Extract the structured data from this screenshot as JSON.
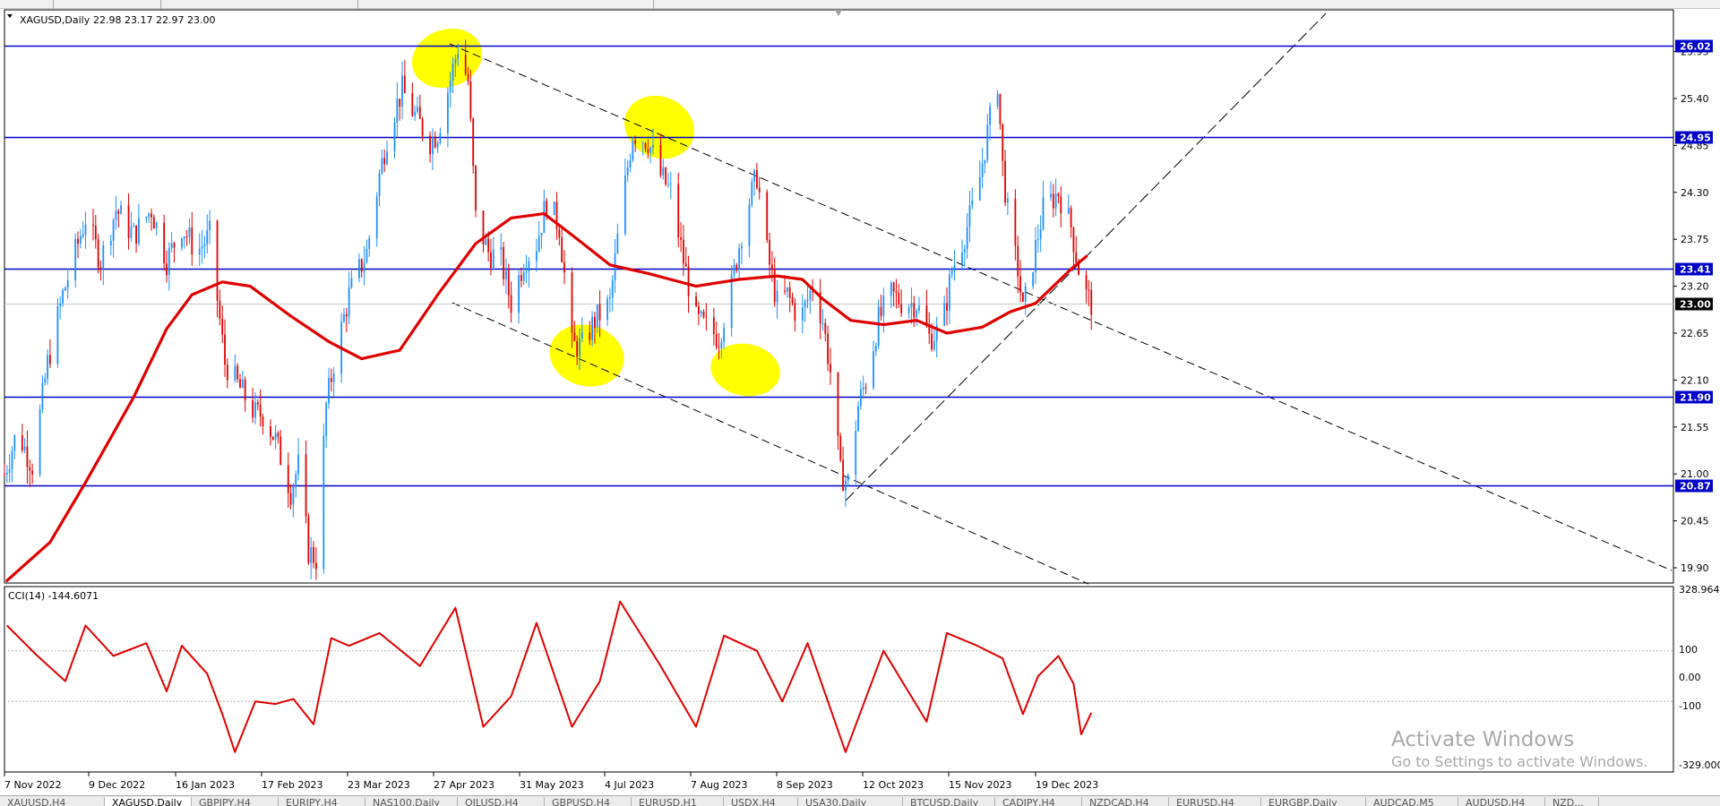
{
  "header": {
    "symbol": "XAGUSD,Daily",
    "ohlc": "22.98 23.17 22.97 23.00",
    "indicator_label": "CCI(14) -144.6071"
  },
  "colors": {
    "bull": "#1e90ff",
    "bear": "#e00000",
    "ma": "#e00000",
    "level_line": "#0000c8",
    "cci": "#e00000",
    "highlight": "#ffff00",
    "trendline": "#000000"
  },
  "horizontal_levels": [
    "26.02",
    "24.95",
    "23.41",
    "21.90",
    "20.87"
  ],
  "current_price": "23.00",
  "watermark": {
    "line1": "Activate Windows",
    "line2": "Go to Settings to activate Windows."
  },
  "tabs": [
    {
      "label": "XAUUSD,H4",
      "active": false
    },
    {
      "label": "XAGUSD,Daily",
      "active": true
    },
    {
      "label": "GBPJPY,H4",
      "active": false
    },
    {
      "label": "EURJPY,H4",
      "active": false
    },
    {
      "label": "NAS100,Daily",
      "active": false
    },
    {
      "label": "OILUSD,H4",
      "active": false
    },
    {
      "label": "GBPUSD,H4",
      "active": false
    },
    {
      "label": "EURUSD,H1",
      "active": false
    },
    {
      "label": "USDX,H4",
      "active": false
    },
    {
      "label": "USA30,Daily",
      "active": false
    },
    {
      "label": "BTCUSD,Daily",
      "active": false
    },
    {
      "label": "CADJPY,H4",
      "active": false
    },
    {
      "label": "NZDCAD,H4",
      "active": false
    },
    {
      "label": "EURUSD,H4",
      "active": false
    },
    {
      "label": "EURGBP,Daily",
      "active": false
    },
    {
      "label": "AUDCAD,M5",
      "active": false
    },
    {
      "label": "AUDUSD,H4",
      "active": false
    },
    {
      "label": "NZD...",
      "active": false
    }
  ],
  "chart_data": [
    {
      "type": "candlestick",
      "title": "XAGUSD,Daily",
      "y_ticks": [
        "25.95",
        "25.40",
        "24.85",
        "24.30",
        "23.75",
        "23.20",
        "22.65",
        "22.10",
        "21.55",
        "21.00",
        "20.45",
        "19.90"
      ],
      "ylim": [
        19.8,
        26.35
      ],
      "x_ticks": [
        "7 Nov 2022",
        "9 Dec 2022",
        "16 Jan 2023",
        "17 Feb 2023",
        "23 Mar 2023",
        "27 Apr 2023",
        "31 May 2023",
        "4 Jul 2023",
        "7 Aug 2023",
        "8 Sep 2023",
        "12 Oct 2023",
        "15 Nov 2023",
        "19 Dec 2023"
      ],
      "price_path": [
        {
          "date": "2022-11-07",
          "close": 21.0
        },
        {
          "date": "2022-11-12",
          "close": 21.5
        },
        {
          "date": "2022-11-18",
          "close": 21.1
        },
        {
          "date": "2022-11-24",
          "close": 22.3
        },
        {
          "date": "2022-11-30",
          "close": 23.1
        },
        {
          "date": "2022-12-05",
          "close": 23.6
        },
        {
          "date": "2022-12-09",
          "close": 24.0
        },
        {
          "date": "2022-12-15",
          "close": 23.5
        },
        {
          "date": "2022-12-21",
          "close": 24.1
        },
        {
          "date": "2022-12-28",
          "close": 23.8
        },
        {
          "date": "2023-01-04",
          "close": 24.1
        },
        {
          "date": "2023-01-10",
          "close": 23.5
        },
        {
          "date": "2023-01-16",
          "close": 23.9
        },
        {
          "date": "2023-01-22",
          "close": 23.6
        },
        {
          "date": "2023-01-27",
          "close": 23.8
        },
        {
          "date": "2023-02-02",
          "close": 22.3
        },
        {
          "date": "2023-02-08",
          "close": 22.0
        },
        {
          "date": "2023-02-14",
          "close": 21.7
        },
        {
          "date": "2023-02-17",
          "close": 21.7
        },
        {
          "date": "2023-02-22",
          "close": 21.4
        },
        {
          "date": "2023-02-28",
          "close": 20.8
        },
        {
          "date": "2023-03-03",
          "close": 21.1
        },
        {
          "date": "2023-03-07",
          "close": 20.1
        },
        {
          "date": "2023-03-10",
          "close": 20.0
        },
        {
          "date": "2023-03-14",
          "close": 21.8
        },
        {
          "date": "2023-03-17",
          "close": 22.3
        },
        {
          "date": "2023-03-23",
          "close": 23.1
        },
        {
          "date": "2023-03-30",
          "close": 23.6
        },
        {
          "date": "2023-04-04",
          "close": 24.5
        },
        {
          "date": "2023-04-08",
          "close": 25.1
        },
        {
          "date": "2023-04-13",
          "close": 25.5
        },
        {
          "date": "2023-04-18",
          "close": 25.2
        },
        {
          "date": "2023-04-24",
          "close": 24.9
        },
        {
          "date": "2023-04-27",
          "close": 25.0
        },
        {
          "date": "2023-05-01",
          "close": 25.5
        },
        {
          "date": "2023-05-05",
          "close": 26.0
        },
        {
          "date": "2023-05-09",
          "close": 25.6
        },
        {
          "date": "2023-05-12",
          "close": 24.0
        },
        {
          "date": "2023-05-17",
          "close": 23.6
        },
        {
          "date": "2023-05-22",
          "close": 23.5
        },
        {
          "date": "2023-05-26",
          "close": 23.0
        },
        {
          "date": "2023-05-31",
          "close": 23.5
        },
        {
          "date": "2023-06-05",
          "close": 23.7
        },
        {
          "date": "2023-06-09",
          "close": 24.2
        },
        {
          "date": "2023-06-14",
          "close": 23.9
        },
        {
          "date": "2023-06-19",
          "close": 22.5
        },
        {
          "date": "2023-06-23",
          "close": 22.5
        },
        {
          "date": "2023-06-28",
          "close": 22.8
        },
        {
          "date": "2023-07-04",
          "close": 23.0
        },
        {
          "date": "2023-07-08",
          "close": 24.0
        },
        {
          "date": "2023-07-13",
          "close": 25.0
        },
        {
          "date": "2023-07-19",
          "close": 24.9
        },
        {
          "date": "2023-07-24",
          "close": 24.5
        },
        {
          "date": "2023-07-28",
          "close": 24.3
        },
        {
          "date": "2023-08-02",
          "close": 23.5
        },
        {
          "date": "2023-08-07",
          "close": 22.8
        },
        {
          "date": "2023-08-12",
          "close": 22.7
        },
        {
          "date": "2023-08-16",
          "close": 22.6
        },
        {
          "date": "2023-08-21",
          "close": 23.2
        },
        {
          "date": "2023-08-26",
          "close": 24.0
        },
        {
          "date": "2023-08-31",
          "close": 24.5
        },
        {
          "date": "2023-09-04",
          "close": 23.6
        },
        {
          "date": "2023-09-08",
          "close": 23.0
        },
        {
          "date": "2023-09-12",
          "close": 23.1
        },
        {
          "date": "2023-09-17",
          "close": 22.8
        },
        {
          "date": "2023-09-22",
          "close": 23.2
        },
        {
          "date": "2023-09-26",
          "close": 22.8
        },
        {
          "date": "2023-09-29",
          "close": 22.2
        },
        {
          "date": "2023-10-03",
          "close": 21.0
        },
        {
          "date": "2023-10-06",
          "close": 20.9
        },
        {
          "date": "2023-10-10",
          "close": 21.8
        },
        {
          "date": "2023-10-13",
          "close": 22.1
        },
        {
          "date": "2023-10-18",
          "close": 22.8
        },
        {
          "date": "2023-10-23",
          "close": 23.1
        },
        {
          "date": "2023-10-28",
          "close": 23.0
        },
        {
          "date": "2023-11-02",
          "close": 23.0
        },
        {
          "date": "2023-11-07",
          "close": 22.6
        },
        {
          "date": "2023-11-12",
          "close": 22.7
        },
        {
          "date": "2023-11-16",
          "close": 23.4
        },
        {
          "date": "2023-11-21",
          "close": 23.8
        },
        {
          "date": "2023-11-26",
          "close": 24.3
        },
        {
          "date": "2023-11-30",
          "close": 25.0
        },
        {
          "date": "2023-12-04",
          "close": 25.6
        },
        {
          "date": "2023-12-06",
          "close": 24.6
        },
        {
          "date": "2023-12-09",
          "close": 23.8
        },
        {
          "date": "2023-12-12",
          "close": 23.4
        },
        {
          "date": "2023-12-14",
          "close": 22.9
        },
        {
          "date": "2023-12-18",
          "close": 23.5
        },
        {
          "date": "2023-12-22",
          "close": 24.1
        },
        {
          "date": "2023-12-28",
          "close": 24.3
        },
        {
          "date": "2024-01-02",
          "close": 23.9
        },
        {
          "date": "2024-01-05",
          "close": 23.4
        },
        {
          "date": "2024-01-08",
          "close": 23.1
        },
        {
          "date": "2024-01-10",
          "close": 23.0
        }
      ],
      "moving_average": [
        {
          "date": "2022-11-08",
          "value": 19.75
        },
        {
          "date": "2022-11-25",
          "value": 20.2
        },
        {
          "date": "2022-12-09",
          "value": 20.9
        },
        {
          "date": "2022-12-28",
          "value": 21.9
        },
        {
          "date": "2023-01-10",
          "value": 22.7
        },
        {
          "date": "2023-01-20",
          "value": 23.1
        },
        {
          "date": "2023-02-01",
          "value": 23.25
        },
        {
          "date": "2023-02-12",
          "value": 23.2
        },
        {
          "date": "2023-02-28",
          "value": 22.85
        },
        {
          "date": "2023-03-15",
          "value": 22.55
        },
        {
          "date": "2023-03-28",
          "value": 22.35
        },
        {
          "date": "2023-04-12",
          "value": 22.45
        },
        {
          "date": "2023-04-27",
          "value": 23.1
        },
        {
          "date": "2023-05-12",
          "value": 23.7
        },
        {
          "date": "2023-05-26",
          "value": 24.0
        },
        {
          "date": "2023-06-08",
          "value": 24.05
        },
        {
          "date": "2023-06-19",
          "value": 23.8
        },
        {
          "date": "2023-07-04",
          "value": 23.45
        },
        {
          "date": "2023-07-19",
          "value": 23.35
        },
        {
          "date": "2023-08-07",
          "value": 23.2
        },
        {
          "date": "2023-08-24",
          "value": 23.28
        },
        {
          "date": "2023-09-08",
          "value": 23.32
        },
        {
          "date": "2023-09-18",
          "value": 23.28
        },
        {
          "date": "2023-09-26",
          "value": 23.05
        },
        {
          "date": "2023-10-07",
          "value": 22.8
        },
        {
          "date": "2023-10-20",
          "value": 22.75
        },
        {
          "date": "2023-11-02",
          "value": 22.8
        },
        {
          "date": "2023-11-14",
          "value": 22.65
        },
        {
          "date": "2023-11-28",
          "value": 22.72
        },
        {
          "date": "2023-12-09",
          "value": 22.9
        },
        {
          "date": "2023-12-19",
          "value": 23.0
        },
        {
          "date": "2024-01-02",
          "value": 23.4
        },
        {
          "date": "2024-01-08",
          "value": 23.55
        }
      ]
    },
    {
      "type": "line",
      "title": "CCI(14) -144.6071",
      "y_ticks": [
        "328.964",
        "100",
        "0.00",
        "-100",
        "-329.000"
      ],
      "ylim": [
        -329.0,
        328.964
      ],
      "levels": [
        100,
        -100
      ],
      "values": [
        {
          "date": "2022-11-08",
          "value": 200
        },
        {
          "date": "2022-11-20",
          "value": 80
        },
        {
          "date": "2022-12-01",
          "value": -20
        },
        {
          "date": "2022-12-09",
          "value": 200
        },
        {
          "date": "2022-12-20",
          "value": 80
        },
        {
          "date": "2023-01-02",
          "value": 130
        },
        {
          "date": "2023-01-10",
          "value": -60
        },
        {
          "date": "2023-01-16",
          "value": 120
        },
        {
          "date": "2023-01-26",
          "value": 10
        },
        {
          "date": "2023-02-01",
          "value": -150
        },
        {
          "date": "2023-02-06",
          "value": -300
        },
        {
          "date": "2023-02-14",
          "value": -100
        },
        {
          "date": "2023-02-22",
          "value": -110
        },
        {
          "date": "2023-03-01",
          "value": -90
        },
        {
          "date": "2023-03-09",
          "value": -190
        },
        {
          "date": "2023-03-16",
          "value": 150
        },
        {
          "date": "2023-03-23",
          "value": 120
        },
        {
          "date": "2023-04-04",
          "value": 170
        },
        {
          "date": "2023-04-20",
          "value": 40
        },
        {
          "date": "2023-05-04",
          "value": 270
        },
        {
          "date": "2023-05-15",
          "value": -200
        },
        {
          "date": "2023-05-26",
          "value": -80
        },
        {
          "date": "2023-06-05",
          "value": 210
        },
        {
          "date": "2023-06-19",
          "value": -200
        },
        {
          "date": "2023-06-30",
          "value": -20
        },
        {
          "date": "2023-07-08",
          "value": 295
        },
        {
          "date": "2023-07-24",
          "value": 40
        },
        {
          "date": "2023-08-07",
          "value": -200
        },
        {
          "date": "2023-08-18",
          "value": 160
        },
        {
          "date": "2023-08-31",
          "value": 100
        },
        {
          "date": "2023-09-10",
          "value": -100
        },
        {
          "date": "2023-09-20",
          "value": 130
        },
        {
          "date": "2023-10-05",
          "value": -300
        },
        {
          "date": "2023-10-20",
          "value": 100
        },
        {
          "date": "2023-11-06",
          "value": -180
        },
        {
          "date": "2023-11-14",
          "value": 170
        },
        {
          "date": "2023-11-26",
          "value": 120
        },
        {
          "date": "2023-12-06",
          "value": 70
        },
        {
          "date": "2023-12-14",
          "value": -150
        },
        {
          "date": "2023-12-20",
          "value": 0
        },
        {
          "date": "2023-12-28",
          "value": 80
        },
        {
          "date": "2024-01-03",
          "value": -30
        },
        {
          "date": "2024-01-06",
          "value": -230
        },
        {
          "date": "2024-01-10",
          "value": -144.6071
        }
      ]
    }
  ]
}
